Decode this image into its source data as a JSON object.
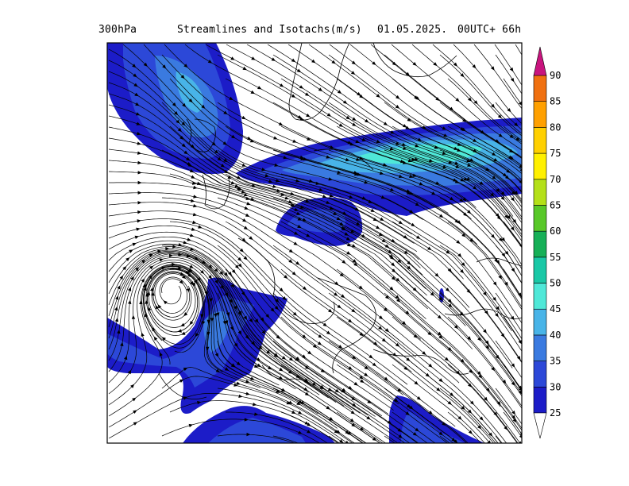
{
  "header": {
    "level": "300hPa",
    "title": "Streamlines and Isotachs(m/s)",
    "date": "01.05.2025.",
    "time": "00UTC+ 66h"
  },
  "colors": {
    "isotach_levels": [
      {
        "value": 25,
        "color": "#1c1cc8"
      },
      {
        "value": 30,
        "color": "#2c48d8"
      },
      {
        "value": 35,
        "color": "#3a7ae0"
      },
      {
        "value": 40,
        "color": "#48b4e8"
      },
      {
        "value": 45,
        "color": "#4fe8d8"
      },
      {
        "value": 50,
        "color": "#19c8a6"
      },
      {
        "value": 55,
        "color": "#16b057"
      },
      {
        "value": 60,
        "color": "#58c828"
      },
      {
        "value": 65,
        "color": "#b4e018"
      },
      {
        "value": 70,
        "color": "#fff000"
      },
      {
        "value": 75,
        "color": "#ffd000"
      },
      {
        "value": 80,
        "color": "#ffa000"
      },
      {
        "value": 85,
        "color": "#f07010"
      },
      {
        "value": 90,
        "color": "#a01070"
      }
    ],
    "top_arrow": "#c8147e"
  },
  "chart_data": {
    "type": "heatmap",
    "title": "Streamlines and Isotachs(m/s)",
    "level": "300hPa",
    "valid": "01.05.2025. 00UTC+ 66h",
    "units": "m/s",
    "colorbar": {
      "ticks": [
        25,
        30,
        35,
        40,
        45,
        50,
        55,
        60,
        65,
        70,
        75,
        80,
        85,
        90
      ],
      "extend": "both"
    },
    "isotach_maxima": [
      {
        "region": "jet core across north-east",
        "max_ms": 47
      },
      {
        "region": "north-west trough jet",
        "max_ms": 40
      },
      {
        "region": "south-west streak",
        "max_ms": 33
      },
      {
        "region": "south-central streak",
        "max_ms": 30
      },
      {
        "region": "south-east streak",
        "max_ms": 30
      }
    ]
  }
}
